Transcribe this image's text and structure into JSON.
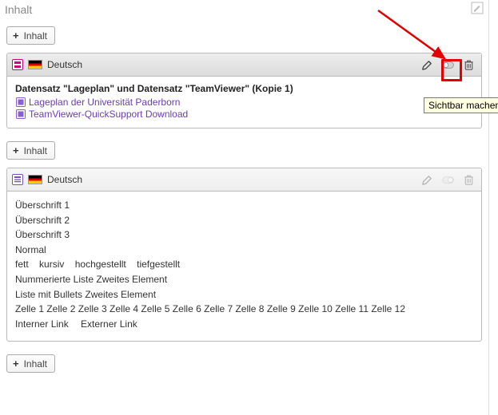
{
  "column": {
    "title": "Inhalt"
  },
  "add_button": {
    "label": "Inhalt",
    "plus": "+"
  },
  "tooltip": "Sichtbar machen",
  "panel1": {
    "language": "Deutsch",
    "title": "Datensatz \"Lageplan\" und Datensatz \"TeamViewer\" (Kopie 1)",
    "links": [
      "Lageplan der Universität Paderborn",
      "TeamViewer-QuickSupport Download"
    ]
  },
  "panel2": {
    "language": "Deutsch",
    "lines": {
      "h1": "Überschrift 1",
      "h2": "Überschrift 2",
      "h3": "Überschrift 3",
      "normal": "Normal",
      "styles": {
        "bold": "fett",
        "italic": "kursiv",
        "super": "hochgestellt",
        "sub": "tiefgestellt"
      },
      "numlist": "Nummerierte Liste Zweites Element",
      "bulletlist": "Liste mit Bullets Zweites Element",
      "cells": "Zelle 1 Zelle 2 Zelle 3 Zelle 4 Zelle 5 Zelle 6 Zelle 7 Zelle 8 Zelle 9 Zelle 10 Zelle 11 Zelle 12",
      "link_int": "Interner Link",
      "link_ext": "Externer Link"
    }
  }
}
